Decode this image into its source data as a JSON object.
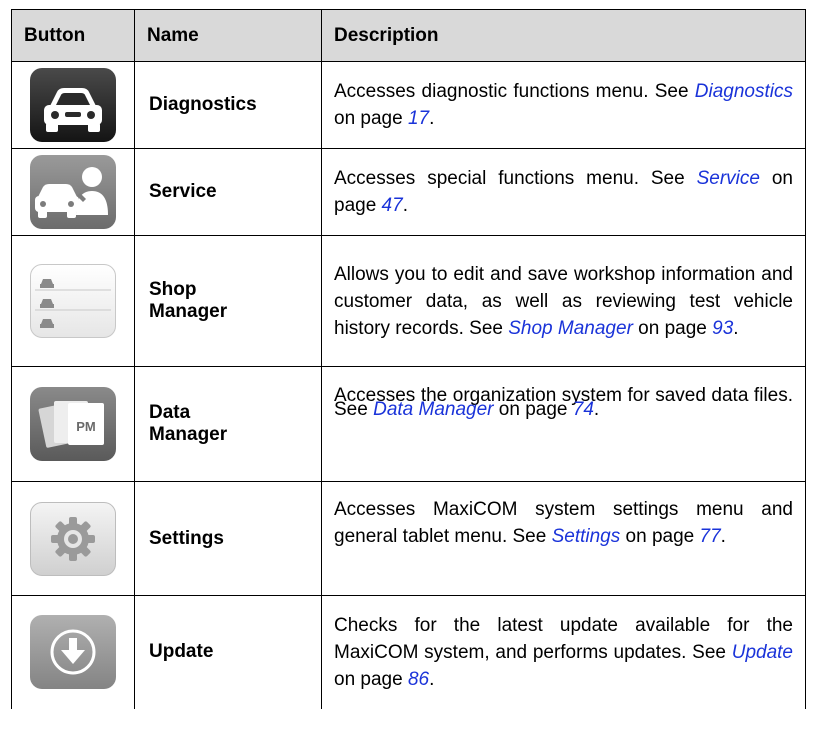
{
  "table": {
    "headers": {
      "button": "Button",
      "name": "Name",
      "description": "Description"
    },
    "rows": [
      {
        "icon": "car-icon",
        "name": "Diagnostics",
        "desc_pre": "Accesses diagnostic functions menu. See ",
        "link": "Diagnostics",
        "desc_mid": " on page ",
        "page": "17",
        "desc_post": "."
      },
      {
        "icon": "car-mechanic-icon",
        "name": "Service",
        "desc_pre": "Accesses special functions menu. See ",
        "link": "Service",
        "desc_mid": " on page ",
        "page": "47",
        "desc_post": "."
      },
      {
        "icon": "vehicle-list-icon",
        "name_line1": "Shop",
        "name_line2": "Manager",
        "desc_pre": "Allows you to edit and save workshop information and customer data, as well as reviewing test vehicle history records. See ",
        "link": "Shop Manager",
        "desc_mid": " on page ",
        "page": "93",
        "desc_post": "."
      },
      {
        "icon": "photo-files-icon",
        "name_line1": "Data",
        "name_line2": "Manager",
        "desc_pre": "Accesses the organization system for saved data files. See ",
        "link": "Data Manager",
        "desc_mid": " on page ",
        "page": "74",
        "desc_post": "."
      },
      {
        "icon": "gear-icon",
        "name": "Settings",
        "desc_pre": "Accesses MaxiCOM system settings menu and general tablet menu. See ",
        "link": "Settings",
        "desc_mid": " on page ",
        "page": "77",
        "desc_post": "."
      },
      {
        "icon": "download-arrow-icon",
        "name": "Update",
        "desc_pre": "Checks for the latest update available for the MaxiCOM system, and performs updates. See ",
        "link": "Update",
        "desc_mid": " on page ",
        "page": "86",
        "desc_post": "."
      }
    ]
  },
  "colors": {
    "header_bg": "#d9d9d9",
    "link": "#1a33d9"
  }
}
